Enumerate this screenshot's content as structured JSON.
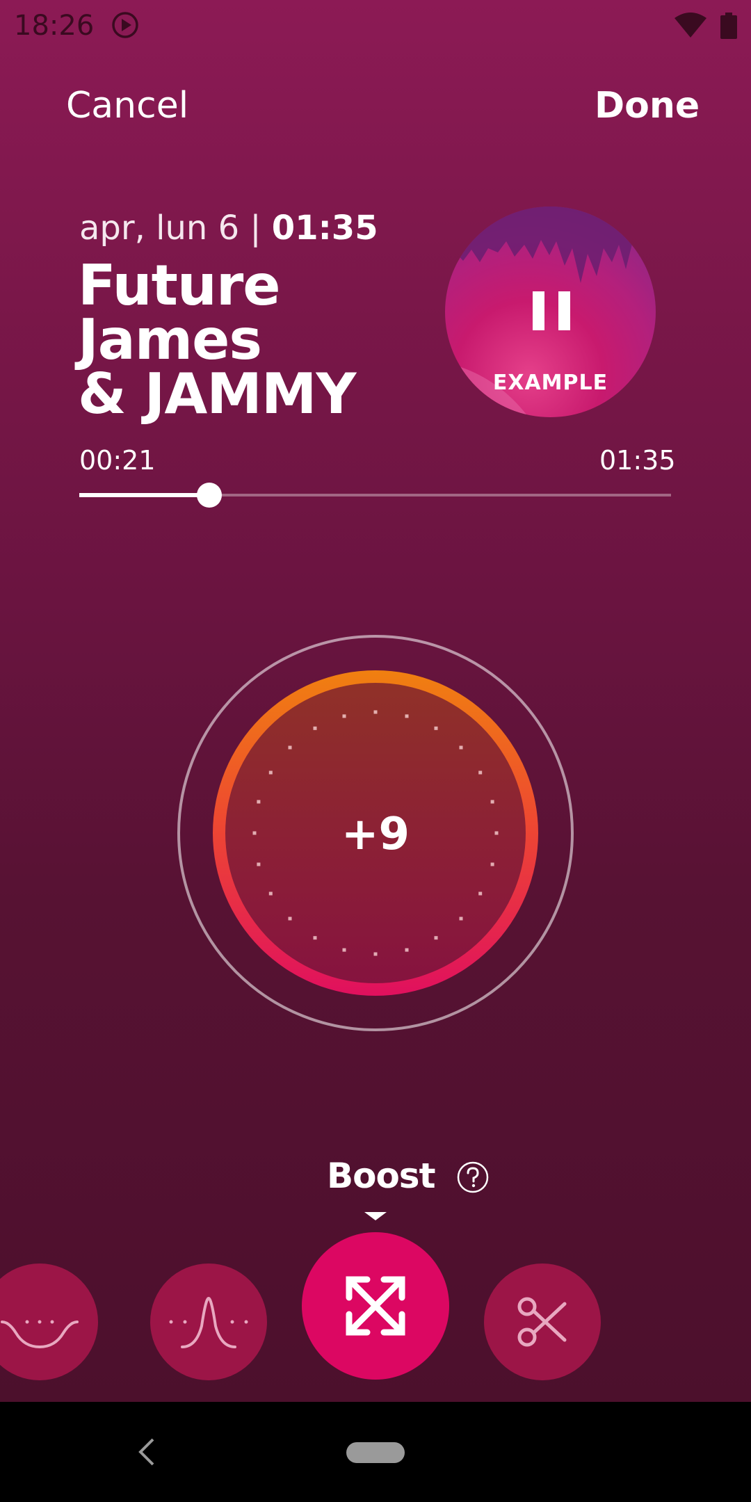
{
  "status_bar": {
    "time": "18:26"
  },
  "actions": {
    "cancel_label": "Cancel",
    "done_label": "Done"
  },
  "recording": {
    "date": "apr, lun 6 | ",
    "duration": "01:35",
    "title_line1": "Future James",
    "title_line2": "& JAMMY",
    "example_label": "EXAMPLE"
  },
  "playback": {
    "elapsed": "00:21",
    "total": "01:35",
    "progress_fraction": 0.22
  },
  "dial": {
    "value": "+9"
  },
  "mode": {
    "label": "Boost"
  },
  "effects": [
    {
      "name": "bass",
      "icon": "bass-curve-icon",
      "selected": false
    },
    {
      "name": "peak",
      "icon": "peak-curve-icon",
      "selected": false
    },
    {
      "name": "boost",
      "icon": "expand-arrows-icon",
      "selected": true
    },
    {
      "name": "trim",
      "icon": "scissors-icon",
      "selected": false
    }
  ],
  "colors": {
    "background_top": "#8c1a55",
    "background_bottom": "#4a0f2b",
    "accent": "#dc0762",
    "dial_gradient_top": "#f08010",
    "dial_gradient_bottom": "#e0105e"
  }
}
